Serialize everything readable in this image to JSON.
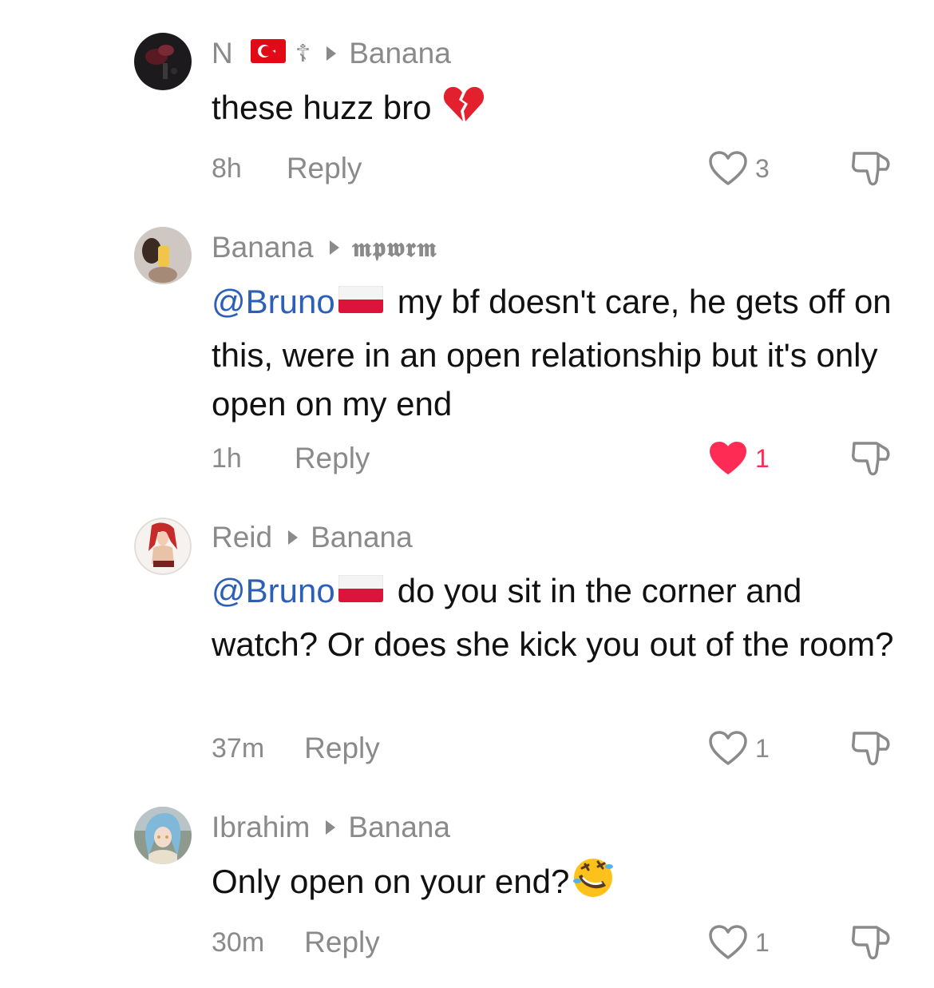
{
  "comments": [
    {
      "author": "N",
      "reply_to": "Banana",
      "text": "these huzz bro",
      "time": "8h",
      "reply_label": "Reply",
      "likes": "3",
      "liked": false,
      "avatar_icon": "avatar-dark-photo",
      "emoji_icon": "broken-heart-emoji"
    },
    {
      "author": "Banana",
      "reply_to": "𝖒𝖕𝖜𝖗𝖒",
      "mention": "@Bruno",
      "text": "my bf doesn't care, he gets off on this, were in an open relationship but it's only open on my end",
      "time": "1h",
      "reply_label": "Reply",
      "likes": "1",
      "liked": true,
      "avatar_icon": "avatar-mirror-selfie"
    },
    {
      "author": "Reid",
      "reply_to": "Banana",
      "mention": "@Bruno",
      "text": "do you sit in the corner and watch? Or does she kick you out of the room?",
      "time": "37m",
      "reply_label": "Reply",
      "likes": "1",
      "liked": false,
      "avatar_icon": "avatar-anime-red-hair"
    },
    {
      "author": "Ibrahim",
      "reply_to": "Banana",
      "text": "Only open on your end?",
      "time": "30m",
      "reply_label": "Reply",
      "likes": "1",
      "liked": false,
      "avatar_icon": "avatar-anime-blue-hair",
      "emoji_icon": "rofl-emoji"
    }
  ],
  "colors": {
    "mention": "#2c5fb8",
    "meta_gray": "#8a8a8a",
    "like_active": "#fe2c55",
    "text": "#111111"
  }
}
